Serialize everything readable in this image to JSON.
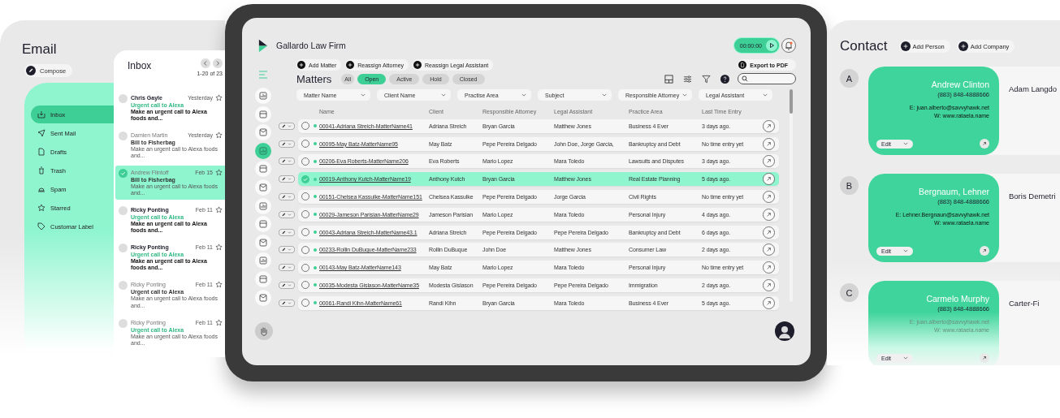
{
  "email": {
    "title": "Email",
    "compose": "Compose",
    "folders": [
      {
        "label": "Inbox",
        "selected": true
      },
      {
        "label": "Sent Mail",
        "selected": false
      },
      {
        "label": "Drafts",
        "selected": false
      },
      {
        "label": "Trash",
        "selected": false
      },
      {
        "label": "Spam",
        "selected": false
      },
      {
        "label": "Starred",
        "selected": false
      },
      {
        "label": "Customar Label",
        "selected": false
      }
    ],
    "inbox": {
      "title": "Inbox",
      "range": "1-20 of 23",
      "messages": [
        {
          "sender": "Chris Gayle",
          "time": "Yesterday",
          "subject": "Urgent call to Alexa",
          "preview": "Make an urgent call to Alexa foods and...",
          "unread": true,
          "urgent": true,
          "selected": false
        },
        {
          "sender": "Damien Martin",
          "time": "Yesterday",
          "subject": "Bill to Fisherbag",
          "preview": "Make an urgent call to Alexa foods and...",
          "unread": false,
          "urgent": false,
          "selected": false
        },
        {
          "sender": "Andrew Flintoff",
          "time": "Feb 15",
          "subject": "Bill to Fisherbag",
          "preview": "Make an urgent call to Alexa foods and...",
          "unread": false,
          "urgent": false,
          "selected": true
        },
        {
          "sender": "Ricky Ponting",
          "time": "Feb 11",
          "subject": "Urgent call to Alexa",
          "preview": "Make an urgent call to Alexa foods and...",
          "unread": true,
          "urgent": true,
          "selected": false
        },
        {
          "sender": "Ricky Ponting",
          "time": "Feb 11",
          "subject": "Urgent call to Alexa",
          "preview": "Make an urgent call to Alexa foods and...",
          "unread": true,
          "urgent": true,
          "selected": false
        },
        {
          "sender": "Ricky Ponting",
          "time": "Feb 11",
          "subject": "Urgent call to Alexa",
          "preview": "Make an urgent call to Alexa foods and...",
          "unread": false,
          "urgent": false,
          "selected": false
        },
        {
          "sender": "Ricky Ponting",
          "time": "Feb 11",
          "subject": "Urgent call to Alexa",
          "preview": "Make an urgent call to Alexa foods and...",
          "unread": false,
          "urgent": true,
          "selected": false
        }
      ]
    }
  },
  "matters": {
    "firm": "Gallardo Law Firm",
    "timer": "00:00:00",
    "actions": [
      "Add Matter",
      "Reassign Attorney",
      "Reassign Legal Assistant"
    ],
    "export": "Export to PDF",
    "title": "Matters",
    "status_tabs": [
      {
        "label": "All",
        "selected": false
      },
      {
        "label": "Open",
        "selected": true
      },
      {
        "label": "Active",
        "selected": false
      },
      {
        "label": "Hold",
        "selected": false
      },
      {
        "label": "Closed",
        "selected": false
      }
    ],
    "nav": [
      {
        "selected": false
      },
      {
        "selected": false
      },
      {
        "selected": false
      },
      {
        "selected": true
      },
      {
        "selected": false
      },
      {
        "selected": false
      },
      {
        "selected": false
      },
      {
        "selected": false
      },
      {
        "selected": false
      },
      {
        "selected": false
      },
      {
        "selected": false
      },
      {
        "selected": false
      }
    ],
    "filters": [
      "Matter Name",
      "Client Name",
      "Practise Area",
      "Subject",
      "Responsible Attorney",
      "Legal Assistant"
    ],
    "columns": [
      "Name",
      "Client",
      "Responsible Attorney",
      "Legal Assistant",
      "Practice Area",
      "Last Time Entry"
    ],
    "rows": [
      {
        "name": "00041-Adriana Streich-MatterName41",
        "client": "Adriana Streich",
        "attorney": "Bryan Garcia",
        "assistant": "Matthew Jones",
        "area": "Business 4 Ever",
        "last": "3 days ago.",
        "selected": false
      },
      {
        "name": "00095-May Batz-MatterName95",
        "client": "May Batz",
        "attorney": "Pepe Pereira Delgado",
        "assistant": "John Doe, Jorge Garcia,",
        "area": "Bankruptcy and Debt",
        "last": "No time entry yet",
        "selected": false
      },
      {
        "name": "00206-Eva Roberts-MatterName206",
        "client": "Eva Roberts",
        "attorney": "Mario Lopez",
        "assistant": "Mara Toledo",
        "area": "Lawsuits and Disputes",
        "last": "3 days ago.",
        "selected": false
      },
      {
        "name": "00019-Anthony Kutch-MatterName19",
        "client": "Anthony Kutch",
        "attorney": "Bryan Garcia",
        "assistant": "Matthew Jones",
        "area": "Real Estate Planning",
        "last": "5 days ago.",
        "selected": true
      },
      {
        "name": "00151-Chelsea Kassulke-MatterName151",
        "client": "Chelsea Kassulke",
        "attorney": "Pepe Pereira Delgado",
        "assistant": "Jorge Garcia",
        "area": "Civil Rights",
        "last": "No time entry yet",
        "selected": false
      },
      {
        "name": "00029-Jameson Parisian-MatterName29",
        "client": "Jameson Parisian",
        "attorney": "Mario Lopez",
        "assistant": "Mara Toledo",
        "area": "Personal Injury",
        "last": "4 days ago.",
        "selected": false
      },
      {
        "name": "00043-Adriana Streich-MatterName43.1",
        "client": "Adriana Streich",
        "attorney": "Pepe Pereira Delgado",
        "assistant": "Pepe Pereira Delgado",
        "area": "Bankruptcy and Debt",
        "last": "6 days ago.",
        "selected": false
      },
      {
        "name": "00233-Rollin DuBuque-MatterName233",
        "client": "Rollin DuBuque",
        "attorney": "John Doe",
        "assistant": "Matthew Jones",
        "area": "Consumer Law",
        "last": "2 days ago.",
        "selected": false
      },
      {
        "name": "00143-May Batz-MatterName143",
        "client": "May Batz",
        "attorney": "Mario Lopez",
        "assistant": "Mara Toledo",
        "area": "Personal Injury",
        "last": "No time entry yet",
        "selected": false
      },
      {
        "name": "00035-Modesta Gislason-MatterName35",
        "client": "Modesta Gislason",
        "attorney": "Pepe Pereira Delgado",
        "assistant": "Pepe Pereira Delgado",
        "area": "Immigration",
        "last": "2 days ago.",
        "selected": false
      },
      {
        "name": "00061-Randi Kihn-MatterName61",
        "client": "Randi Kihn",
        "attorney": "Bryan Garcia",
        "assistant": "Mara Toledo",
        "area": "Business 4 Ever",
        "last": "5 days ago.",
        "selected": false
      }
    ]
  },
  "contact": {
    "title": "Contact",
    "actions": [
      "Add Person",
      "Add Company"
    ],
    "groups": [
      {
        "letter": "A",
        "name": "Andrew Clinton",
        "phone": "(883) 848-4888666",
        "email": "E: juan.alberto@savvyhawk.net",
        "web": "W: www.rataela.name",
        "edit": "Edit",
        "next": "Adam Langdo"
      },
      {
        "letter": "B",
        "name": "Bergnaum, Lehner",
        "phone": "(883) 848-4888666",
        "email": "E: Lehner.Bergnaun@savvyhawk.net",
        "web": "W: www.rataela.name",
        "edit": "Edit",
        "next": "Boris Demetri"
      },
      {
        "letter": "C",
        "name": "Carmelo Murphy",
        "phone": "(883) 848-4888666",
        "email": "E: juan.alberto@savvyhawk.net",
        "web": "W: www.rataela.name",
        "edit": "Edit",
        "next": "Carter-Fi"
      }
    ]
  }
}
